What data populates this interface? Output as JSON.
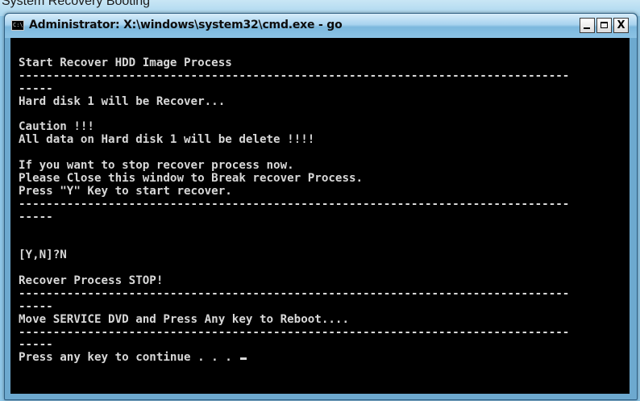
{
  "desktop": {
    "partial_text": "System Recovery Booting"
  },
  "window": {
    "title": "Administrator: X:\\windows\\system32\\cmd.exe - go",
    "icon_text": "C:\\",
    "controls": {
      "minimize": "_",
      "maximize": "□",
      "close": "X"
    }
  },
  "console": {
    "lines": [
      "",
      "Start Recover HDD Image Process",
      "--------------------------------------------------------------------------------",
      "-----",
      "Hard disk 1 will be Recover...",
      "",
      "Caution !!!",
      "All data on Hard disk 1 will be delete !!!!",
      "",
      "If you want to stop recover process now.",
      "Please Close this window to Break recover Process.",
      "Press \"Y\" Key to start recover.",
      "--------------------------------------------------------------------------------",
      "-----",
      "",
      "",
      "[Y,N]?N",
      "",
      "Recover Process STOP!",
      "--------------------------------------------------------------------------------",
      "-----",
      "Move SERVICE DVD and Press Any key to Reboot....",
      "--------------------------------------------------------------------------------",
      "-----",
      "Press any key to continue . . . "
    ]
  },
  "colors": {
    "console_bg": "#000000",
    "console_fg": "#d8d8d8",
    "titlebar": "#a8d3ef"
  }
}
